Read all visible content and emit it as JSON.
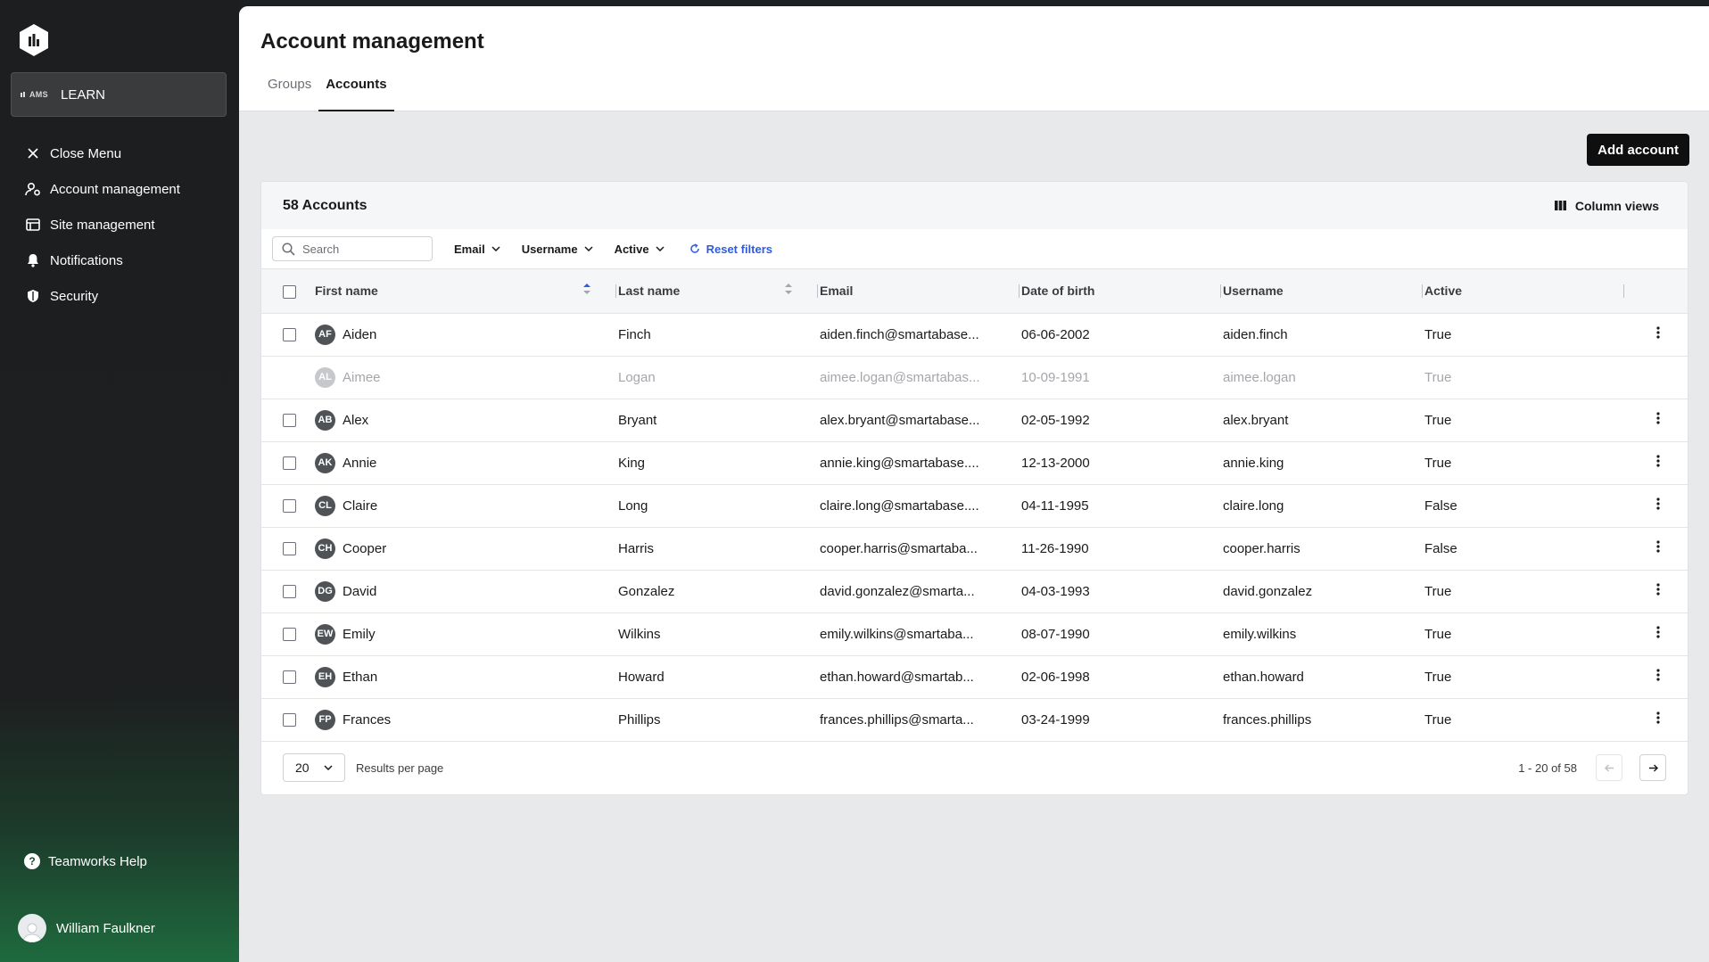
{
  "sidebar": {
    "app_badge": "AMS",
    "app_name": "LEARN",
    "items": [
      {
        "label": "Close Menu",
        "icon": "close-icon"
      },
      {
        "label": "Account management",
        "icon": "user-gear-icon"
      },
      {
        "label": "Site management",
        "icon": "browser-icon"
      },
      {
        "label": "Notifications",
        "icon": "bell-icon"
      },
      {
        "label": "Security",
        "icon": "shield-icon"
      }
    ],
    "help_label": "Teamworks Help",
    "user_name": "William Faulkner"
  },
  "header": {
    "title": "Account management",
    "tabs": [
      {
        "label": "Groups",
        "active": false
      },
      {
        "label": "Accounts",
        "active": true
      }
    ]
  },
  "actions": {
    "add_account": "Add account"
  },
  "card": {
    "title": "58 Accounts",
    "column_views": "Column views",
    "search_placeholder": "Search",
    "filters": [
      "Email",
      "Username",
      "Active"
    ],
    "reset_filters": "Reset filters"
  },
  "table": {
    "columns": [
      "First name",
      "Last name",
      "Email",
      "Date of birth",
      "Username",
      "Active"
    ],
    "rows": [
      {
        "initials": "AF",
        "first": "Aiden",
        "last": "Finch",
        "email": "aiden.finch@smartabase...",
        "dob": "06-06-2002",
        "username": "aiden.finch",
        "active": "True",
        "disabled": false
      },
      {
        "initials": "AL",
        "first": "Aimee",
        "last": "Logan",
        "email": "aimee.logan@smartabas...",
        "dob": "10-09-1991",
        "username": "aimee.logan",
        "active": "True",
        "disabled": true
      },
      {
        "initials": "AB",
        "first": "Alex",
        "last": "Bryant",
        "email": "alex.bryant@smartabase...",
        "dob": "02-05-1992",
        "username": "alex.bryant",
        "active": "True",
        "disabled": false
      },
      {
        "initials": "AK",
        "first": "Annie",
        "last": "King",
        "email": "annie.king@smartabase....",
        "dob": "12-13-2000",
        "username": "annie.king",
        "active": "True",
        "disabled": false
      },
      {
        "initials": "CL",
        "first": "Claire",
        "last": "Long",
        "email": "claire.long@smartabase....",
        "dob": "04-11-1995",
        "username": "claire.long",
        "active": "False",
        "disabled": false
      },
      {
        "initials": "CH",
        "first": "Cooper",
        "last": "Harris",
        "email": "cooper.harris@smartaba...",
        "dob": "11-26-1990",
        "username": "cooper.harris",
        "active": "False",
        "disabled": false
      },
      {
        "initials": "DG",
        "first": "David",
        "last": "Gonzalez",
        "email": "david.gonzalez@smarta...",
        "dob": "04-03-1993",
        "username": "david.gonzalez",
        "active": "True",
        "disabled": false
      },
      {
        "initials": "EW",
        "first": "Emily",
        "last": "Wilkins",
        "email": "emily.wilkins@smartaba...",
        "dob": "08-07-1990",
        "username": "emily.wilkins",
        "active": "True",
        "disabled": false
      },
      {
        "initials": "EH",
        "first": "Ethan",
        "last": "Howard",
        "email": "ethan.howard@smartab...",
        "dob": "02-06-1998",
        "username": "ethan.howard",
        "active": "True",
        "disabled": false
      },
      {
        "initials": "FP",
        "first": "Frances",
        "last": "Phillips",
        "email": "frances.phillips@smarta...",
        "dob": "03-24-1999",
        "username": "frances.phillips",
        "active": "True",
        "disabled": false
      }
    ]
  },
  "pagination": {
    "per_page": "20",
    "per_page_label": "Results per page",
    "range": "1 - 20 of 58"
  },
  "colors": {
    "accent": "#2d5be3",
    "sidebar_bg": "#1d1e20",
    "primary_button": "#0f0f10"
  }
}
